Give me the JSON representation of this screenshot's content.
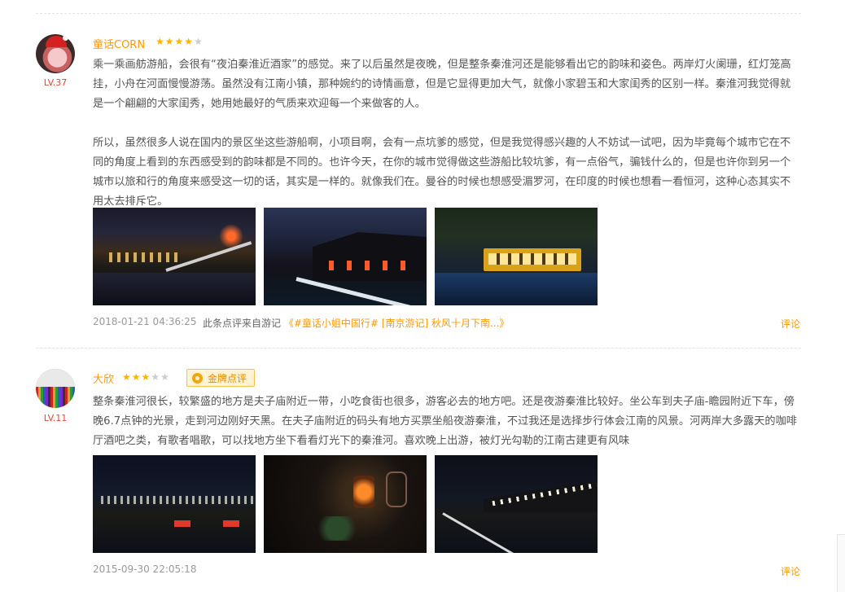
{
  "reviews": [
    {
      "username": "童话CORN",
      "level": "LV.37",
      "rating": 4,
      "paragraphs": [
        "乘一乘画舫游船，会很有“夜泊秦淮近酒家”的感觉。来了以后虽然是夜晚，但是整条秦淮河还是能够看出它的韵味和姿色。两岸灯火阑珊，红灯笼高挂，小舟在河面慢慢游荡。虽然没有江南小镇，那种婉约的诗情画意，但是它显得更加大气，就像小家碧玉和大家闺秀的区别一样。秦淮河我觉得就是一个翩翩的大家闺秀，她用她最好的气质来欢迎每一个来做客的人。",
        "所以，虽然很多人说在国内的景区坐这些游船啊，小项目啊，会有一点坑爹的感觉，但是我觉得感兴趣的人不妨试一试吧，因为毕竟每个城市它在不同的角度上看到的东西感受到的韵味都是不同的。也许今天，在你的城市觉得做这些游船比较坑爹，有一点俗气，骗钱什么的，但是也许你到另一个城市以旅和行的角度来感受这一切的话，其实是一样的。就像我们在。曼谷的时候也想感受湄罗河，在印度的时候也想看一看恒河，这种心态其实不用太去排斥它。"
      ],
      "date": "2018-01-21 04:36:25",
      "source_prefix": "此条点评来自游记",
      "source_link": "《#童话小姐中国行#  [南京游记] 秋风十月下南...》",
      "comment_label": "评论"
    },
    {
      "username": "大欣",
      "level": "LV.11",
      "rating": 3,
      "badge": "金牌点评",
      "paragraphs": [
        "整条秦淮河很长，较繁盛的地方是夫子庙附近一带，小吃食街也很多，游客必去的地方吧。还是夜游秦淮比较好。坐公车到夫子庙-瞻园附近下车，傍晚6.7点钟的光景，走到河边刚好天黑。在夫子庙附近的码头有地方买票坐船夜游秦淮，不过我还是选择步行体会江南的风景。河两岸大多露天的咖啡厅酒吧之类，有歌者唱歌，可以找地方坐下看看灯光下的秦淮河。喜欢晚上出游，被灯光勾勒的江南古建更有风味"
      ],
      "date": "2015-09-30 22:05:18",
      "comment_label": "评论"
    }
  ],
  "colors": {
    "username": "#ff9900",
    "level": "#e4453a",
    "star_on": "#ffb400",
    "star_off": "#cccccc",
    "badge_bg": "#fff3d4",
    "badge_border": "#f3c24a"
  },
  "icons": {
    "star": "★",
    "medal": "medal-icon"
  }
}
